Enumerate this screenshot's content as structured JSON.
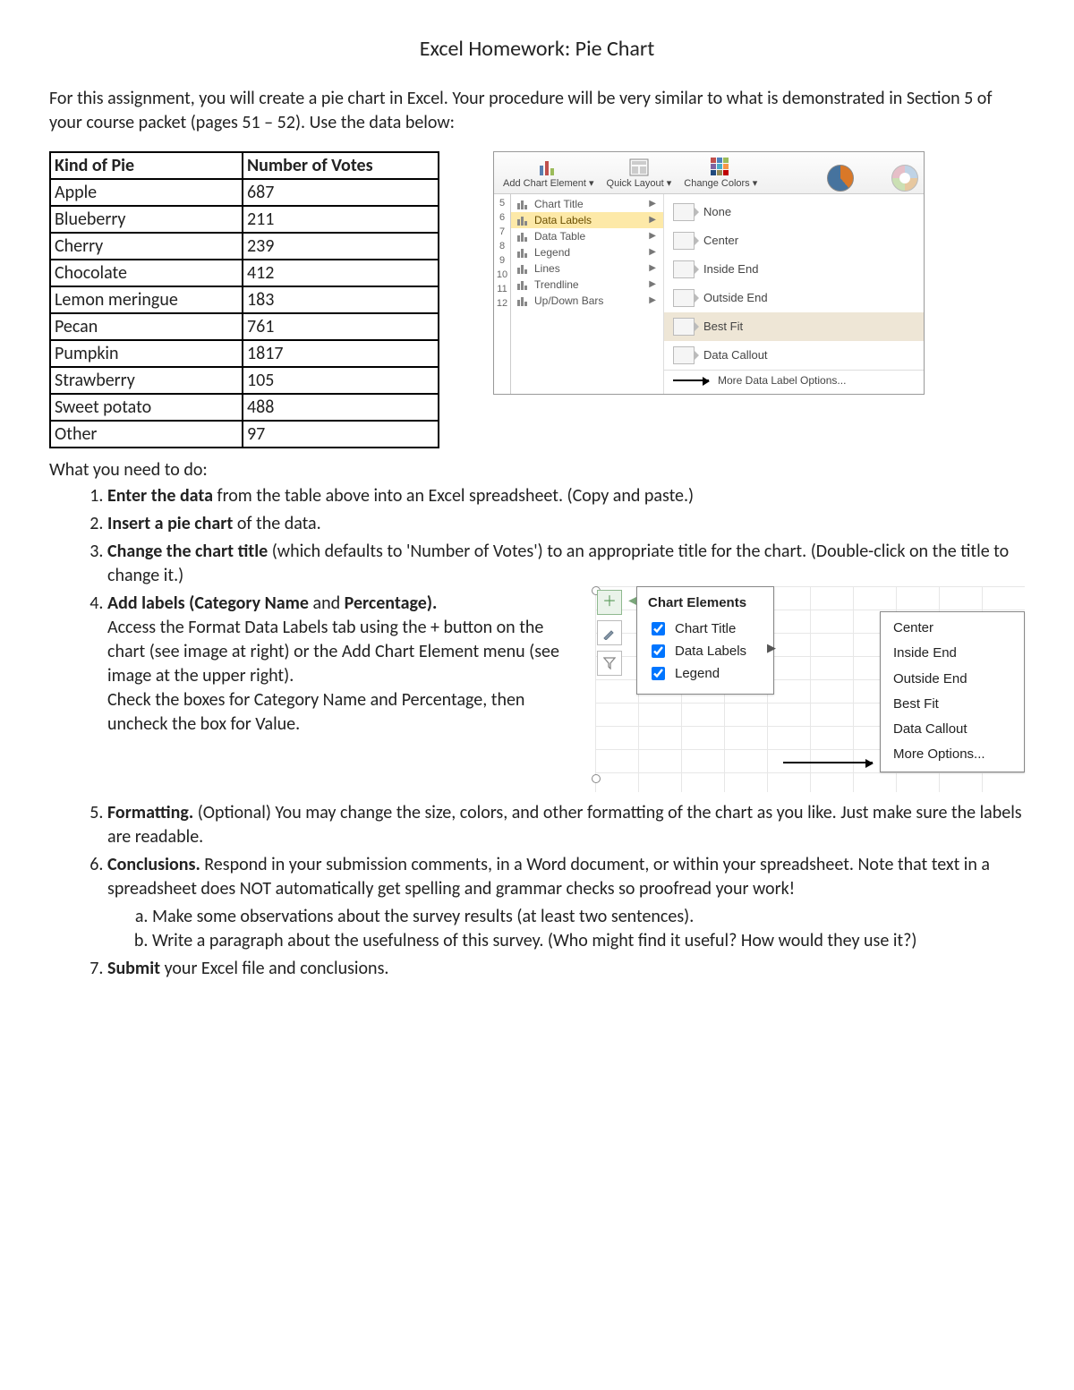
{
  "title": "Excel Homework: Pie Chart",
  "intro": "For this assignment, you will create a pie chart in Excel. Your procedure will be very similar to what is demonstrated in Section 5 of your course packet (pages 51 – 52). Use the data below:",
  "table": {
    "headers": [
      "Kind of Pie",
      "Number of Votes"
    ],
    "rows": [
      [
        "Apple",
        "687"
      ],
      [
        "Blueberry",
        "211"
      ],
      [
        "Cherry",
        "239"
      ],
      [
        "Chocolate",
        "412"
      ],
      [
        "Lemon meringue",
        "183"
      ],
      [
        "Pecan",
        "761"
      ],
      [
        "Pumpkin",
        "1817"
      ],
      [
        "Strawberry",
        "105"
      ],
      [
        "Sweet potato",
        "488"
      ],
      [
        "Other",
        "97"
      ]
    ]
  },
  "ribbon": {
    "buttons": {
      "addChart": "Add Chart Element ▾",
      "quick": "Quick Layout ▾",
      "colors": "Change Colors ▾"
    },
    "menu": [
      "Chart Title",
      "Data Labels",
      "Data Table",
      "Legend",
      "Lines",
      "Trendline",
      "Up/Down Bars"
    ],
    "selectedMenu": "Data Labels",
    "submenu": [
      "None",
      "Center",
      "Inside End",
      "Outside End",
      "Best Fit",
      "Data Callout"
    ],
    "more": "More Data Label Options...",
    "rownums": [
      "5",
      "6",
      "7",
      "8",
      "9",
      "10",
      "11",
      "12"
    ]
  },
  "instructions_heading": "What you need to do:",
  "steps": {
    "s1": {
      "bold": "Enter the data",
      "rest": " from the table above into an Excel spreadsheet. (Copy and paste.)"
    },
    "s2": {
      "bold": "Insert a pie chart",
      "rest": " of the data."
    },
    "s3": {
      "bold": "Change the chart title",
      "rest": " (which defaults to 'Number of Votes') to an appropriate title for the chart. (Double-click on the title to change it.)"
    },
    "s4": {
      "bold1": "Add labels (Category Name",
      "mid": " and ",
      "bold2": "Percentage).",
      "body": "Access the Format Data Labels tab using the + button on the chart (see image at right) or the Add Chart Element menu (see image at the upper right).\nCheck the boxes for Category Name and Percentage, then uncheck the box for Value."
    },
    "s5": {
      "bold": "Formatting.",
      "rest": " (Optional) You may change the size, colors, and other formatting of the chart as you like. Just make sure the labels are readable."
    },
    "s6": {
      "bold": "Conclusions.",
      "rest": " Respond in your submission comments, in a Word document, or within your spreadsheet. Note that text in a spreadsheet does NOT automatically get spelling and grammar checks so proofread your work!",
      "a": "Make some observations about the survey results (at least two sentences).",
      "b": "Write a paragraph about the usefulness of this survey. (Who might find it useful? How would they use it?)"
    },
    "s7": {
      "bold": "Submit",
      "rest": " your Excel file and conclusions."
    }
  },
  "chart_elements_panel": {
    "title": "Chart Elements",
    "items": [
      "Chart Title",
      "Data Labels",
      "Legend"
    ],
    "submenu": [
      "Center",
      "Inside End",
      "Outside End",
      "Best Fit",
      "Data Callout",
      "More Options..."
    ]
  },
  "chart_data": {
    "type": "pie",
    "title": "Number of Votes",
    "categories": [
      "Apple",
      "Blueberry",
      "Cherry",
      "Chocolate",
      "Lemon meringue",
      "Pecan",
      "Pumpkin",
      "Strawberry",
      "Sweet potato",
      "Other"
    ],
    "values": [
      687,
      211,
      239,
      412,
      183,
      761,
      1817,
      105,
      488,
      97
    ]
  }
}
